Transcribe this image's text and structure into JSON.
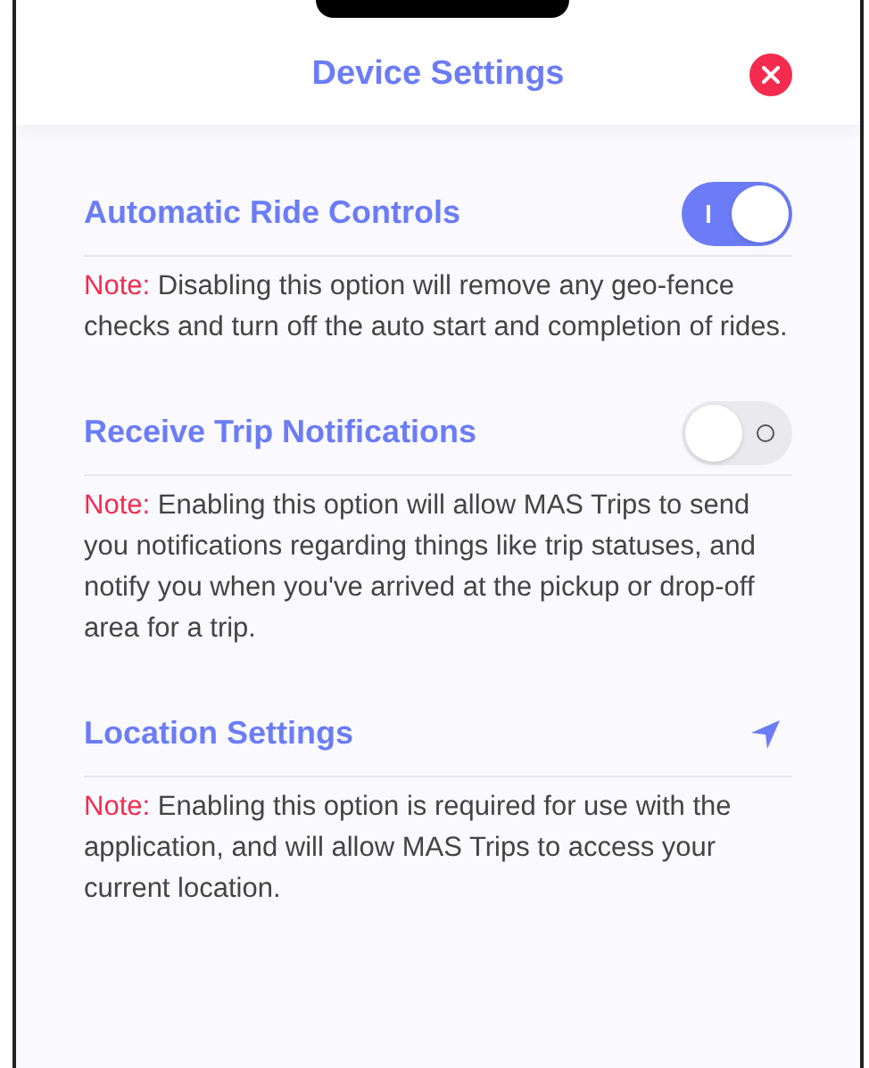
{
  "header": {
    "title": "Device Settings"
  },
  "settings": [
    {
      "kind": "toggle",
      "title": "Automatic Ride Controls",
      "on": true,
      "note_label": "Note:",
      "note": "Disabling this option will remove any geo-fence checks and turn off the auto start and completion of rides."
    },
    {
      "kind": "toggle",
      "title": "Receive Trip Notifications",
      "on": false,
      "note_label": "Note:",
      "note": "Enabling this option will allow MAS Trips to send you notifications regarding things like trip statuses, and notify you when you've arrived at the pickup or drop-off area for a trip."
    },
    {
      "kind": "link",
      "title": "Location Settings",
      "note_label": "Note:",
      "note": "Enabling this option is required for use with the application, and will allow MAS Trips to access your current location."
    }
  ]
}
